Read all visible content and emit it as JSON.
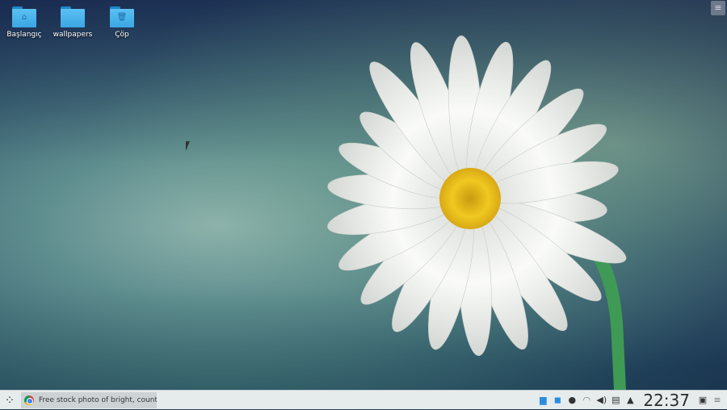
{
  "desktop": {
    "icons": [
      {
        "label": "Başlangıç",
        "icon": "home-folder-icon"
      },
      {
        "label": "wallpapers",
        "icon": "folder-icon"
      },
      {
        "label": "Çöp",
        "icon": "trash-folder-icon"
      }
    ],
    "panel_menu_glyph": "≡"
  },
  "taskbar": {
    "launcher_glyph": "⁘",
    "tasks": [
      {
        "title": "Free stock photo of bright, countr...",
        "icon": "chrome-icon"
      }
    ],
    "tray": {
      "clock": "22:37",
      "menu_glyph": "≡"
    }
  },
  "colors": {
    "taskbar": "#e6ebec",
    "folder": "#3aa6e4",
    "petal": "#f4f5f2",
    "center": "#e8c21a"
  }
}
